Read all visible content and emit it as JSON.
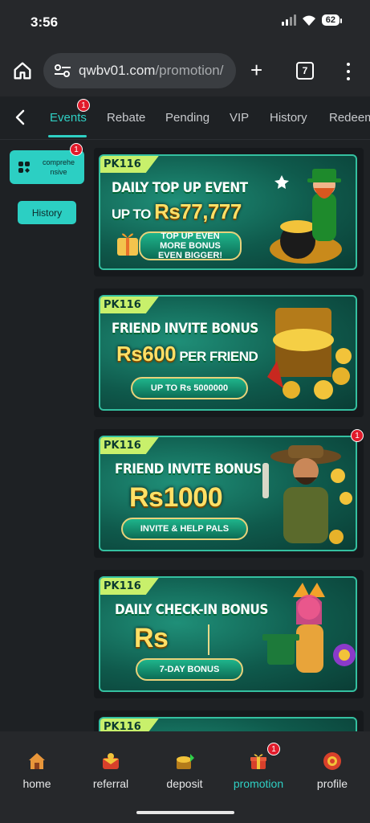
{
  "status_bar": {
    "time": "3:56",
    "battery": "62"
  },
  "browser": {
    "url_domain": "qwbv01.com",
    "url_path": "/promotion/",
    "tab_count": "7"
  },
  "nav": {
    "tabs": [
      {
        "label": "Events",
        "active": true,
        "badge": "1"
      },
      {
        "label": "Rebate"
      },
      {
        "label": "Pending"
      },
      {
        "label": "VIP"
      },
      {
        "label": "History"
      },
      {
        "label": "Redeem"
      }
    ]
  },
  "sidebar": {
    "category_label": "comprehe nsive",
    "category_badge": "1",
    "history_label": "History"
  },
  "promotions": [
    {
      "brand": "PK116",
      "line1": "DAILY TOP UP EVENT",
      "line2_prefix": "UP TO ",
      "line2": "Rs77,777",
      "pill": "TOP UP EVEN MORE BONUS EVEN BIGGER!"
    },
    {
      "brand": "PK116",
      "line1": "FRIEND INVITE BONUS",
      "line2": "Rs600",
      "line2_suffix": " PER FRIEND",
      "pill": "UP TO Rs 5000000"
    },
    {
      "brand": "PK116",
      "line1": "FRIEND INVITE BONUS",
      "line2": "Rs1000",
      "pill": "INVITE & HELP PALS",
      "badge": "1"
    },
    {
      "brand": "PK116",
      "line1": "DAILY CHECK-IN BONUS",
      "line2": "Rs",
      "pill": "7-DAY BONUS"
    },
    {
      "brand": "PK116"
    }
  ],
  "bottom_nav": {
    "items": [
      {
        "label": "home",
        "icon": "home-icon"
      },
      {
        "label": "referral",
        "icon": "referral-icon"
      },
      {
        "label": "deposit",
        "icon": "deposit-icon"
      },
      {
        "label": "promotion",
        "icon": "promotion-icon",
        "active": true,
        "badge": "1"
      },
      {
        "label": "profile",
        "icon": "profile-icon"
      }
    ]
  },
  "colors": {
    "accent": "#2fd0c4",
    "badge": "#e21b2b",
    "background": "#1e2124"
  }
}
